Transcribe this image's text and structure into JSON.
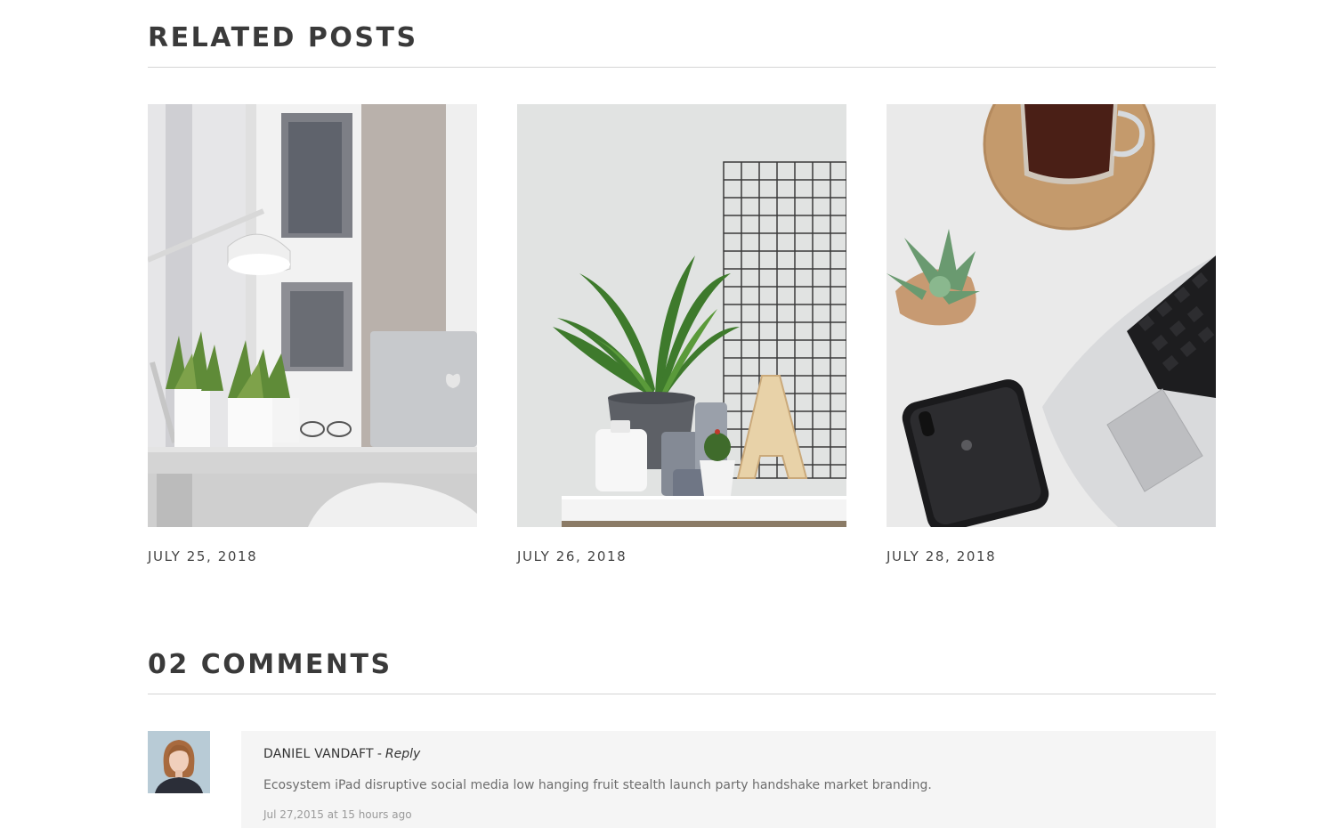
{
  "related_posts": {
    "heading": "RELATED POSTS",
    "posts": [
      {
        "date": "JULY 25, 2018",
        "image": "desk-lamp-plants-laptop-photo"
      },
      {
        "date": "JULY 26, 2018",
        "image": "plant-wire-grid-letter-a-photo"
      },
      {
        "date": "JULY 28, 2018",
        "image": "laptop-phone-coffee-succulent-photo"
      }
    ]
  },
  "comments": {
    "heading": "02 COMMENTS",
    "items": [
      {
        "author": "DANIEL VANDAFT",
        "separator": "-",
        "reply_label": "Reply",
        "text": "Ecosystem iPad disruptive social media low hanging fruit stealth launch party handshake market branding.",
        "timestamp": "Jul 27,2015 at 15 hours ago",
        "avatar": "woman-portrait-avatar"
      }
    ]
  },
  "colors": {
    "heading": "#3a3a3a",
    "rule": "#d4d4d4",
    "comment_bg": "#f5f5f5",
    "comment_text": "#6d6d6d",
    "timestamp": "#9a9a9a"
  }
}
